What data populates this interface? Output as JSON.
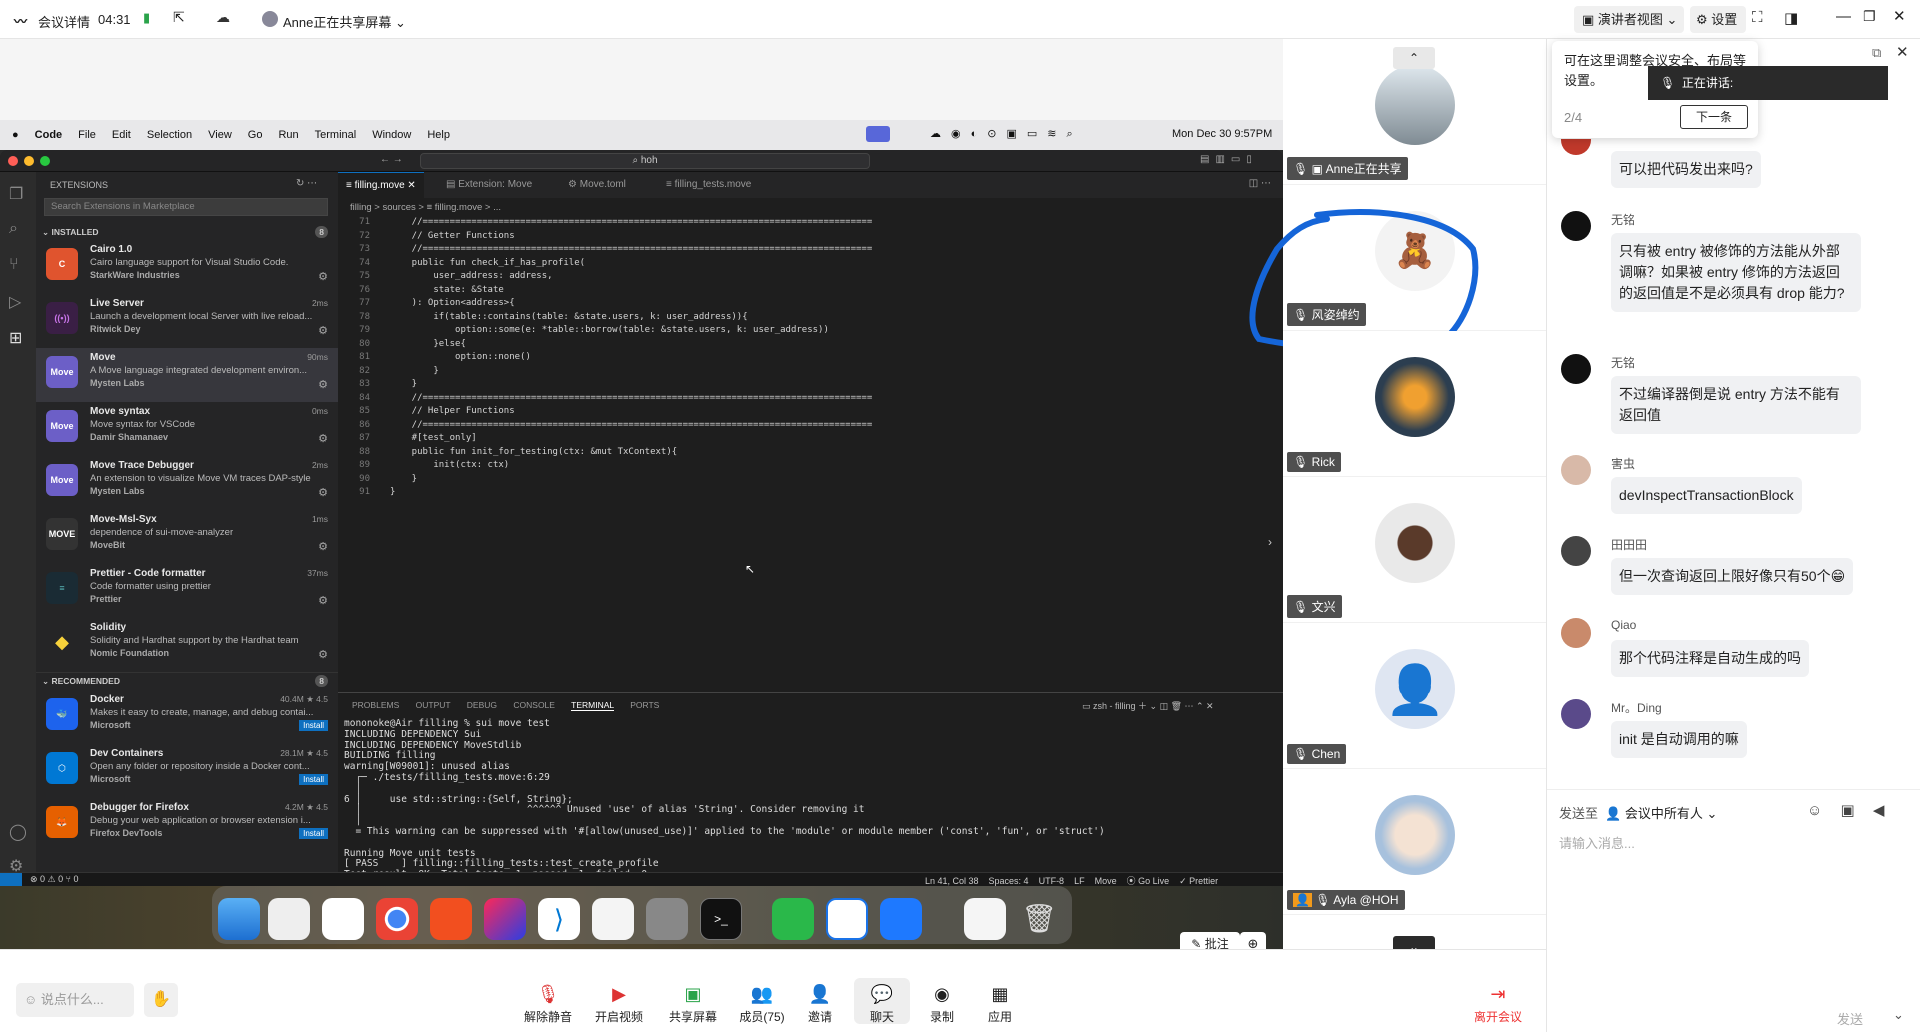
{
  "topbar": {
    "meeting_details": "会议详情",
    "timer": "04:31",
    "sharing": "Anne正在共享屏幕",
    "presenter_view": "演讲者视图",
    "settings": "设置"
  },
  "tooltip": {
    "text": "可在这里调整会议安全、布局等设置。",
    "page": "2/4",
    "next": "下一条",
    "speaking": "正在讲话:"
  },
  "menubar": {
    "items": [
      "Code",
      "File",
      "Edit",
      "Selection",
      "View",
      "Go",
      "Run",
      "Terminal",
      "Window",
      "Help"
    ],
    "clock": "Mon Dec 30  9:57PM"
  },
  "vscode": {
    "search": "hoh",
    "sidebar_title": "EXTENSIONS",
    "search_placeholder": "Search Extensions in Marketplace",
    "installed": "INSTALLED",
    "installed_count": "8",
    "recommended": "RECOMMENDED",
    "recommended_count": "8",
    "extensions": [
      {
        "name": "Cairo 1.0",
        "desc": "Cairo language support for Visual Studio Code.",
        "pub": "StarkWare Industries",
        "time": ""
      },
      {
        "name": "Live Server",
        "desc": "Launch a development local Server with live reload...",
        "pub": "Ritwick Dey",
        "time": "2ms"
      },
      {
        "name": "Move",
        "desc": "A Move language integrated development environ...",
        "pub": "Mysten Labs",
        "time": "90ms"
      },
      {
        "name": "Move syntax",
        "desc": "Move syntax for VSCode",
        "pub": "Damir Shamanaev",
        "time": "0ms"
      },
      {
        "name": "Move Trace Debugger",
        "desc": "An extension to visualize Move VM traces DAP-style",
        "pub": "Mysten Labs",
        "time": "2ms"
      },
      {
        "name": "Move-Msl-Syx",
        "desc": "dependence of sui-move-analyzer",
        "pub": "MoveBit",
        "time": "1ms"
      },
      {
        "name": "Prettier - Code formatter",
        "desc": "Code formatter using prettier",
        "pub": "Prettier",
        "time": "37ms"
      },
      {
        "name": "Solidity",
        "desc": "Solidity and Hardhat support by the Hardhat team",
        "pub": "Nomic Foundation",
        "time": ""
      }
    ],
    "recommended_items": [
      {
        "name": "Docker",
        "desc": "Makes it easy to create, manage, and debug contai...",
        "pub": "Microsoft",
        "stats": "40.4M ★ 4.5",
        "btn": "Install"
      },
      {
        "name": "Dev Containers",
        "desc": "Open any folder or repository inside a Docker cont...",
        "pub": "Microsoft",
        "stats": "28.1M ★ 4.5",
        "btn": "Install"
      },
      {
        "name": "Debugger for Firefox",
        "desc": "Debug your web application or browser extension i...",
        "pub": "Firefox DevTools",
        "stats": "4.2M ★ 4.5",
        "btn": "Install"
      }
    ],
    "tabs": [
      "filling.move",
      "Extension: Move",
      "Move.toml",
      "filling_tests.move"
    ],
    "breadcrumb": "filling  >  sources  >  ≡ filling.move  >  ...",
    "line_numbers": "71\n72\n73\n74\n75\n76\n77\n78\n79\n80\n81\n82\n83\n84\n85\n86\n87\n88\n89\n90\n91",
    "code": "    //===================================================================================\n    // Getter Functions\n    //===================================================================================\n    public fun check_if_has_profile(\n        user_address: address,\n        state: &State\n    ): Option<address>{\n        if(table::contains(table: &state.users, k: user_address)){\n            option::some(e: *table::borrow(table: &state.users, k: user_address))\n        }else{\n            option::none()\n        }\n    }\n    //===================================================================================\n    // Helper Functions\n    //===================================================================================\n    #[test_only]\n    public fun init_for_testing(ctx: &mut TxContext){\n        init(ctx: ctx)\n    }\n}",
    "panel_tabs": [
      "PROBLEMS",
      "OUTPUT",
      "DEBUG CONSOLE",
      "TERMINAL",
      "PORTS"
    ],
    "terminal_name": "zsh - filling",
    "terminal": "mononoke@Air filling % sui move test\nINCLUDING DEPENDENCY Sui\nINCLUDING DEPENDENCY MoveStdlib\nBUILDING filling\nwarning[W09001]: unused alias\n  ┌─ ./tests/filling_tests.move:6:29\n  │\n6 │     use std::string::{Self, String};\n  │                             ^^^^^^ Unused 'use' of alias 'String'. Consider removing it\n  │\n  = This warning can be suppressed with '#[allow(unused_use)]' applied to the 'module' or module member ('const', 'fun', or 'struct')\n\nRunning Move unit tests\n[ PASS    ] filling::filling_tests::test_create_profile\nTest result: OK. Total tests: 1; passed: 1; failed: 0\nmononoke@Air filling % ",
    "status_left": "⊗ 0 ⚠ 0   ⑂ 0",
    "status_right": "Ln 41, Col 38    Spaces: 4    UTF-8    LF    Move    ⦿ Go Live    ✓ Prettier"
  },
  "annotate": "批注",
  "participants": [
    {
      "name": "Anne正在共享",
      "color": "#cfd8e3"
    },
    {
      "name": "风姿绰约",
      "color": "#f3f3f3"
    },
    {
      "name": "Rick",
      "color": "#2c3e50"
    },
    {
      "name": "文兴",
      "color": "#e9e9e9"
    },
    {
      "name": "Chen",
      "color": "#dfe6f2"
    },
    {
      "name": "Ayla @HOH",
      "color": "#c5d6ea"
    }
  ],
  "chat": {
    "messages": [
      {
        "name": "",
        "text": "可以把代码发出来吗?",
        "color": "#c0392b"
      },
      {
        "name": "无铭",
        "text": "只有被 entry 被修饰的方法能从外部调嘛？如果被 entry 修饰的方法返回的返回值是不是必须具有 drop 能力?",
        "color": "#111"
      },
      {
        "name": "无铭",
        "text": "不过编译器倒是说 entry 方法不能有返回值",
        "color": "#111"
      },
      {
        "name": "害虫",
        "text": "devInspectTransactionBlock",
        "color": "#d8b9a8"
      },
      {
        "name": "田田田",
        "text": "但一次查询返回上限好像只有50个😁",
        "color": "#444"
      },
      {
        "name": "Qiao",
        "text": "那个代码注释是自动生成的吗",
        "color": "#c98a6b"
      },
      {
        "name": "Mr。Ding",
        "text": "init 是自动调用的嘛",
        "color": "#5a4a8a"
      }
    ],
    "send_to": "发送至",
    "recipient": "会议中所有人",
    "placeholder": "请输入消息...",
    "send": "发送"
  },
  "bottom": {
    "say_something": "说点什么...",
    "buttons": [
      "解除静音",
      "开启视频",
      "共享屏幕",
      "成员(75)",
      "邀请",
      "聊天",
      "录制",
      "应用"
    ],
    "leave": "离开会议"
  }
}
